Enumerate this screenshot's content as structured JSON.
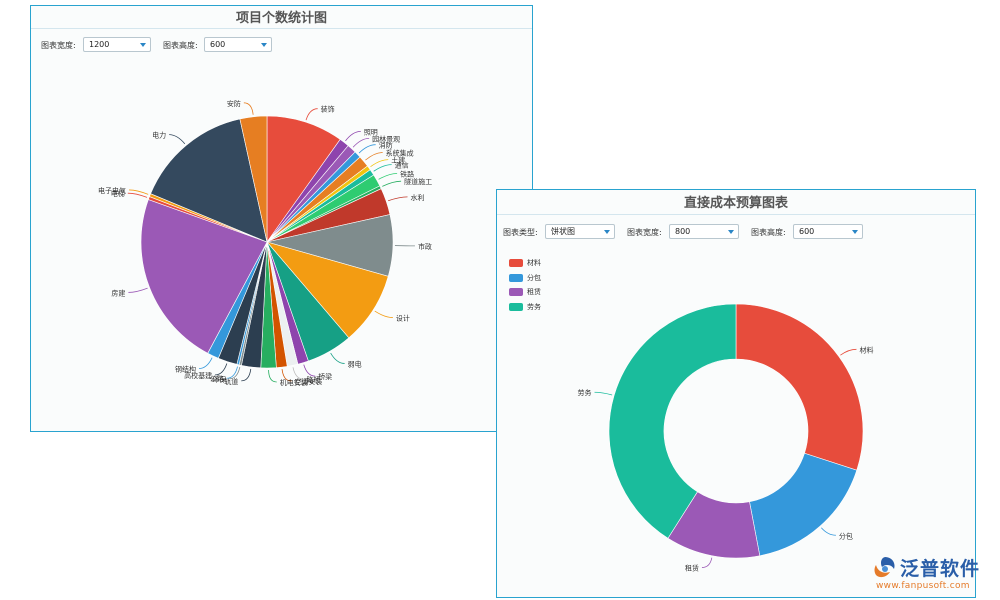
{
  "colors": {
    "border": "#29a3cf",
    "select_caret": "#2a86c6"
  },
  "panel1": {
    "title": "项目个数统计图",
    "width_label": "图表宽度:",
    "width_value": "1200",
    "height_label": "图表高度:",
    "height_value": "600"
  },
  "panel2": {
    "title": "直接成本预算图表",
    "type_label": "图表类型:",
    "type_value": "饼状图",
    "width_label": "图表宽度:",
    "width_value": "800",
    "height_label": "图表高度:",
    "height_value": "600"
  },
  "logo": {
    "text": "泛普软件",
    "url": "www.fanpusoft.com"
  },
  "chart_data": [
    {
      "type": "pie",
      "title": "项目个数统计图",
      "slices": [
        {
          "label": "装饰",
          "value": 10,
          "color": "#e74c3c"
        },
        {
          "label": "照明",
          "value": 1.3,
          "color": "#8e44ad"
        },
        {
          "label": "园林景观",
          "value": 1.2,
          "color": "#9b59b6"
        },
        {
          "label": "消防",
          "value": 0.9,
          "color": "#3498db"
        },
        {
          "label": "系统集成",
          "value": 1.5,
          "color": "#e67e22"
        },
        {
          "label": "土建",
          "value": 0.6,
          "color": "#f1c40f"
        },
        {
          "label": "通信",
          "value": 0.8,
          "color": "#1abc9c"
        },
        {
          "label": "铁路",
          "value": 1.6,
          "color": "#2ecc71"
        },
        {
          "label": "隧道施工",
          "value": 0.4,
          "color": "#27ae60"
        },
        {
          "label": "水利",
          "value": 3.5,
          "color": "#c0392b"
        },
        {
          "label": "市政",
          "value": 8.0,
          "color": "#7f8c8d"
        },
        {
          "label": "设计",
          "value": 9.5,
          "color": "#f39c12"
        },
        {
          "label": "弱电",
          "value": 6.0,
          "color": "#16a085"
        },
        {
          "label": "桥梁",
          "value": 1.4,
          "color": "#8e44ad"
        },
        {
          "label": "路桥",
          "value": 1.4,
          "color": "#ecf0f1"
        },
        {
          "label": "空调安装",
          "value": 1.4,
          "color": "#d35400"
        },
        {
          "label": "机电安装",
          "value": 2.0,
          "color": "#27ae60"
        },
        {
          "label": "轨道",
          "value": 2.5,
          "color": "#2c3e50"
        },
        {
          "label": "环保",
          "value": 0.3,
          "color": "#7f8c8d"
        },
        {
          "label": "公路",
          "value": 0.3,
          "color": "#3498db"
        },
        {
          "label": "高校基建",
          "value": 2.5,
          "color": "#2c3e50"
        },
        {
          "label": "钢结构",
          "value": 1.5,
          "color": "#3498db"
        },
        {
          "label": "房建",
          "value": 23.0,
          "color": "#9b59b6"
        },
        {
          "label": "电梯",
          "value": 0.4,
          "color": "#e74c3c"
        },
        {
          "label": "电子电气",
          "value": 0.4,
          "color": "#f39c12"
        },
        {
          "label": "电力",
          "value": 15.5,
          "color": "#34495e"
        },
        {
          "label": "安防",
          "value": 3.5,
          "color": "#e67e22"
        }
      ]
    },
    {
      "type": "pie",
      "title": "直接成本预算图表",
      "legend": [
        "材料",
        "分包",
        "租赁",
        "劳务"
      ],
      "legend_position": "top-left",
      "slices": [
        {
          "label": "材料",
          "value": 30,
          "color": "#e74c3c"
        },
        {
          "label": "分包",
          "value": 17,
          "color": "#3498db"
        },
        {
          "label": "租赁",
          "value": 12,
          "color": "#9b59b6"
        },
        {
          "label": "劳务",
          "value": 41,
          "color": "#1abc9c"
        }
      ]
    }
  ]
}
